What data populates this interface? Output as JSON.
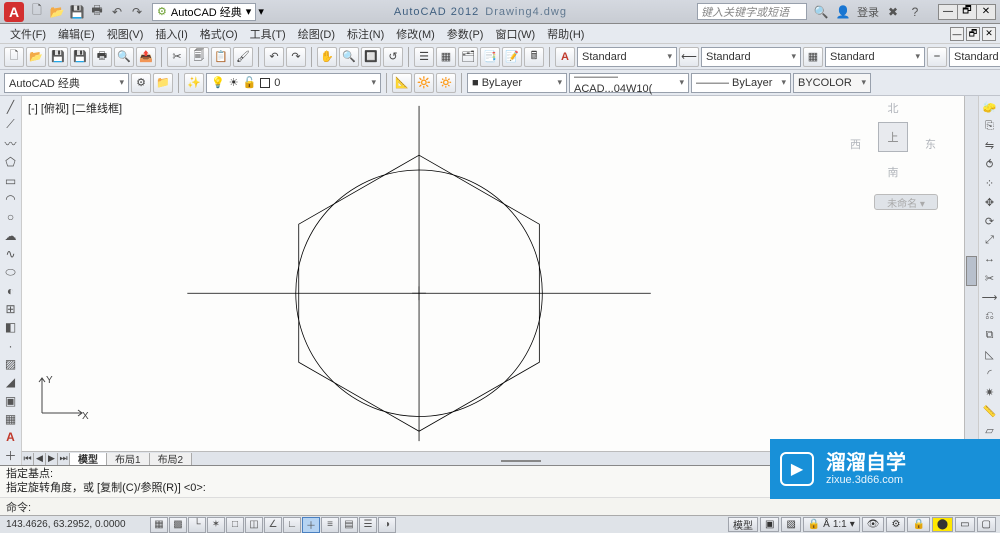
{
  "title": {
    "app": "AutoCAD 2012",
    "doc": "Drawing4.dwg"
  },
  "workspace_top": "AutoCAD 经典",
  "search_placeholder": "键入关键字或短语",
  "login": "登录",
  "menus": [
    "文件(F)",
    "编辑(E)",
    "视图(V)",
    "插入(I)",
    "格式(O)",
    "工具(T)",
    "绘图(D)",
    "标注(N)",
    "修改(M)",
    "参数(P)",
    "窗口(W)",
    "帮助(H)"
  ],
  "row2": {
    "text_style": "Standard",
    "dim_style": "Standard",
    "table_style": "Standard",
    "ml_style": "Standard"
  },
  "row3": {
    "workspace": "AutoCAD 经典",
    "layer": "0",
    "color": "■ ByLayer",
    "ltype": "———— ACAD...04W10(",
    "lweight": "——— ByLayer",
    "plotstyle": "BYCOLOR"
  },
  "viewport": "[-] [俯视] [二维线框]",
  "navcube": {
    "n": "北",
    "s": "南",
    "w": "西",
    "e": "东",
    "top": "上"
  },
  "viewbadge": "未命名 ▾",
  "tabs": [
    "模型",
    "布局1",
    "布局2"
  ],
  "cmd": {
    "h1": "指定基点:",
    "h2": "指定旋转角度，或 [复制(C)/参照(R)] <0>:",
    "prompt": "命令:"
  },
  "status": {
    "coords": "143.4626, 63.2952, 0.0000",
    "right": {
      "model": "模型",
      "scale": "1:1"
    }
  },
  "watermark": {
    "brand": "溜溜自学",
    "url": "zixue.3d66.com"
  }
}
